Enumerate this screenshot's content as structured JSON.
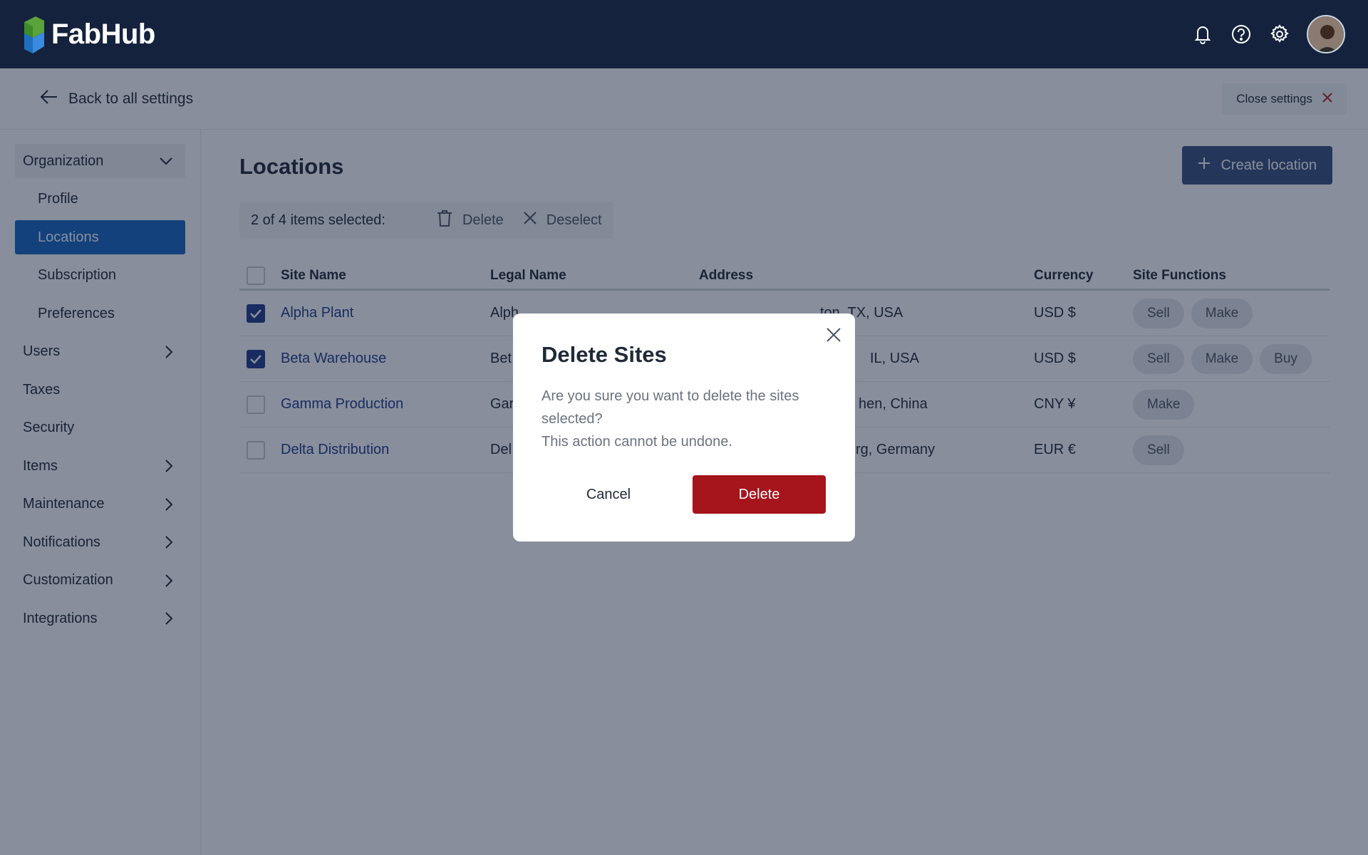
{
  "app": {
    "name": "FabHub",
    "colors": {
      "topbar": "#15223d",
      "primary": "#36507c",
      "active_nav": "#1565c0",
      "danger": "#a6141c"
    }
  },
  "topbar": {
    "icons": [
      "bell-icon",
      "help-icon",
      "gear-icon"
    ],
    "avatar": "avatar"
  },
  "settings_header": {
    "back_label": "Back to all settings",
    "close_label": "Close settings"
  },
  "sidebar": {
    "items": [
      {
        "label": "Organization",
        "type": "group",
        "chevron": "down"
      },
      {
        "label": "Profile",
        "type": "sub"
      },
      {
        "label": "Locations",
        "type": "sub",
        "active": true
      },
      {
        "label": "Subscription",
        "type": "sub"
      },
      {
        "label": "Preferences",
        "type": "sub"
      },
      {
        "label": "Users",
        "chevron": "right"
      },
      {
        "label": "Taxes"
      },
      {
        "label": "Security"
      },
      {
        "label": "Items",
        "chevron": "right"
      },
      {
        "label": "Maintenance",
        "chevron": "right"
      },
      {
        "label": "Notifications",
        "chevron": "right"
      },
      {
        "label": "Customization",
        "chevron": "right"
      },
      {
        "label": "Integrations",
        "chevron": "right"
      }
    ]
  },
  "main": {
    "title": "Locations",
    "create_label": "Create location",
    "bulk": {
      "count_label": "2 of 4 items selected:",
      "delete_label": "Delete",
      "deselect_label": "Deselect"
    },
    "table": {
      "headers": {
        "site": "Site Name",
        "legal": "Legal Name",
        "address": "Address",
        "currency": "Currency",
        "functions": "Site Functions"
      },
      "rows": [
        {
          "checked": true,
          "site": "Alpha Plant",
          "legal": "Alph",
          "address": "ton, TX, USA",
          "currency": "USD $",
          "functions": [
            "Sell",
            "Make"
          ]
        },
        {
          "checked": true,
          "site": "Beta Warehouse",
          "legal": "Bet",
          "address": "IL, USA",
          "currency": "USD $",
          "functions": [
            "Sell",
            "Make",
            "Buy"
          ]
        },
        {
          "checked": false,
          "site": "Gamma Production",
          "legal": "Gar",
          "address": "hen, China",
          "currency": "CNY ¥",
          "functions": [
            "Make"
          ]
        },
        {
          "checked": false,
          "site": "Delta Distribution",
          "legal": "Del",
          "address": "rg, Germany",
          "currency": "EUR €",
          "functions": [
            "Sell"
          ]
        }
      ]
    }
  },
  "modal": {
    "title": "Delete Sites",
    "body_line1": "Are you sure you want to delete the sites selected?",
    "body_line2": "This action cannot be undone.",
    "cancel_label": "Cancel",
    "delete_label": "Delete"
  }
}
